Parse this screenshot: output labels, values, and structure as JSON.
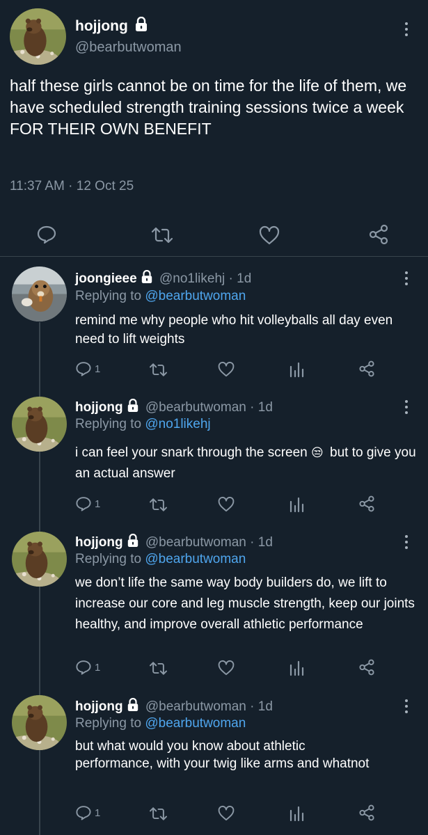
{
  "main_tweet": {
    "display_name": "hojjong",
    "handle": "@bearbutwoman",
    "text": "half these girls cannot be on time for the life of them, we have scheduled strength training sessions twice a week FOR THEIR OWN BENEFIT",
    "timestamp": "11:37 AM · 12 Oct 25"
  },
  "replies": [
    {
      "display_name": "joongieee",
      "handle": "@no1likehj",
      "time": "· 1d",
      "replying_prefix": "Replying to",
      "replying_to": "@bearbutwoman",
      "text": "remind me why people who hit volleyballs all day even need to lift weights",
      "reply_count": "1",
      "avatar_icon": "squirrel-avatar"
    },
    {
      "display_name": "hojjong",
      "handle": "@bearbutwoman",
      "time": "· 1d",
      "replying_prefix": "Replying to",
      "replying_to": "@no1likehj",
      "text_before_emoji": "i can feel your snark through the screen",
      "emoji": "😒",
      "text_after_emoji": "but to give you an actual answer",
      "reply_count": "1",
      "avatar_icon": "bear-avatar"
    },
    {
      "display_name": "hojjong",
      "handle": "@bearbutwoman",
      "time": "· 1d",
      "replying_prefix": "Replying to",
      "replying_to": "@bearbutwoman",
      "text": "we don’t life the same way body builders do, we lift to increase our core and leg muscle strength, keep our joints healthy, and improve overall athletic performance",
      "reply_count": "1",
      "avatar_icon": "bear-avatar"
    },
    {
      "display_name": "hojjong",
      "handle": "@bearbutwoman",
      "time": "· 1d",
      "replying_prefix": "Replying to",
      "replying_to": "@bearbutwoman",
      "text": "but what would you know about athletic performance, with your twig like arms and whatnot",
      "reply_count": "1",
      "avatar_icon": "bear-avatar"
    }
  ],
  "colors": {
    "background": "#15202b",
    "muted": "#8b98a5",
    "link": "#4fa6ee",
    "divider": "#38444d"
  }
}
